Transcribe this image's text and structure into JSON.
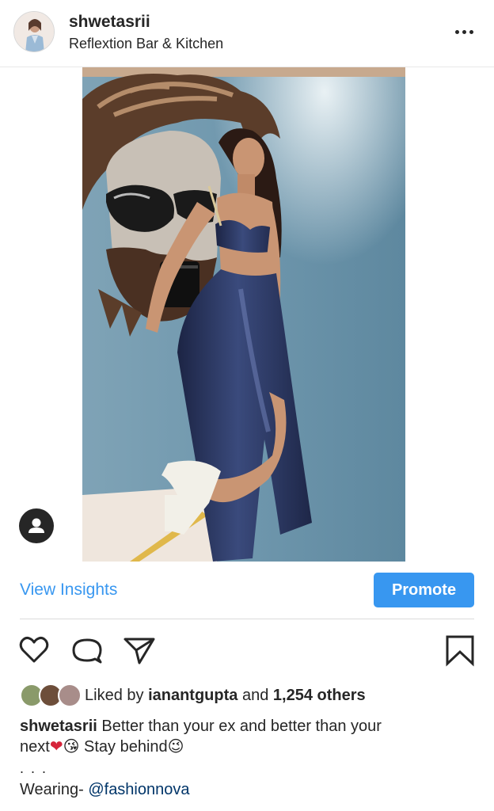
{
  "post": {
    "username": "shwetasrii",
    "location": "Reflextion Bar & Kitchen"
  },
  "icons": {
    "more": "more-horizontal-icon",
    "tag": "user-tag-icon",
    "like": "heart-icon",
    "comment": "comment-icon",
    "share": "send-icon",
    "save": "bookmark-icon"
  },
  "actions": {
    "insights_label": "View Insights",
    "promote_label": "Promote"
  },
  "likes": {
    "prefix": "Liked by ",
    "user": "ianantgupta",
    "middle": " and ",
    "count": "1,254 others"
  },
  "caption": {
    "username": "shwetasrii",
    "text_line1": " Better than your ex and better than your",
    "text_next": "next",
    "emoji_heart": "❤",
    "emoji_kiss": "😘",
    "text_stay": " Stay behind",
    "emoji_wink": "😉",
    "more_dots": ". . .",
    "wearing": "Wearing- ",
    "mention": "@fashionnova"
  },
  "colors": {
    "accent": "#3897f0",
    "text": "#262626",
    "divider": "#dbdbdb",
    "wall": "#6f97ad"
  }
}
